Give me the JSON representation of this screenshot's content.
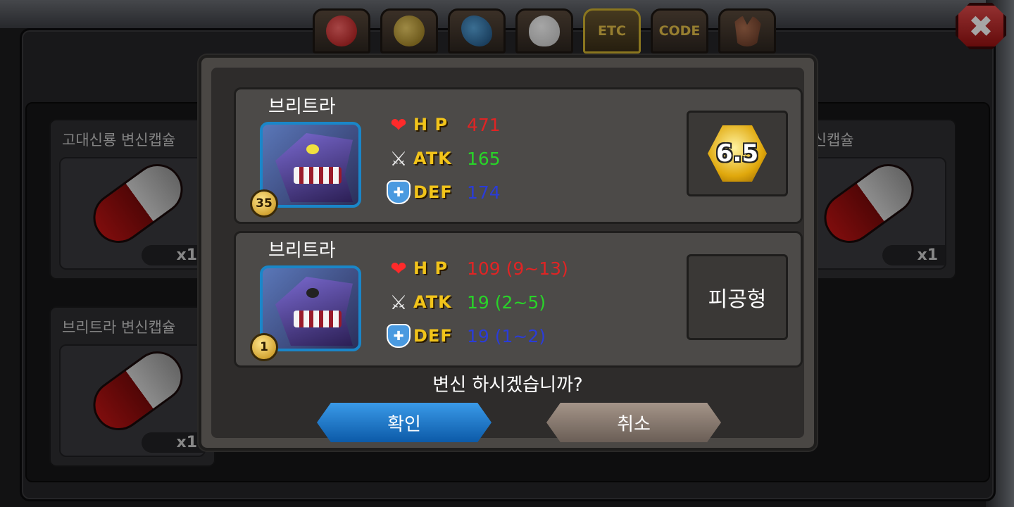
{
  "tabs": [
    {
      "icon": "fruit-icon",
      "label": ""
    },
    {
      "icon": "gold-ore-icon",
      "label": ""
    },
    {
      "icon": "fish-icon",
      "label": ""
    },
    {
      "icon": "egg-icon",
      "label": ""
    },
    {
      "icon": "",
      "label": "ETC"
    },
    {
      "icon": "",
      "label": "CODE"
    },
    {
      "icon": "wolf-icon",
      "label": ""
    }
  ],
  "close_label": "✖",
  "inventory": {
    "items": [
      {
        "title": "고대신룡 변신캡슐",
        "qty": "x1"
      },
      {
        "title": "브리트라 변신캡슐",
        "qty": "x1"
      },
      {
        "title": "베티 변신캡슐",
        "qty": "x1"
      }
    ]
  },
  "dialog": {
    "current": {
      "name": "브리트라",
      "level": "35",
      "hp_label": "H P",
      "hp": "471",
      "atk_label": "ATK",
      "atk": "165",
      "def_label": "DEF",
      "def": "174",
      "grade": "6.5"
    },
    "result": {
      "name": "브리트라",
      "level": "1",
      "hp_label": "H P",
      "hp": "109 (9~13)",
      "atk_label": "ATK",
      "atk": "19 (2~5)",
      "def_label": "DEF",
      "def": "19 (1~2)",
      "type": "피공형"
    },
    "question": "변신 하시겠습니까?",
    "confirm": "확인",
    "cancel": "취소"
  },
  "colors": {
    "hp": "#e02424",
    "atk": "#28d428",
    "def": "#2a3cd8",
    "confirm": "#1a72c8",
    "cancel": "#8a7c72"
  }
}
